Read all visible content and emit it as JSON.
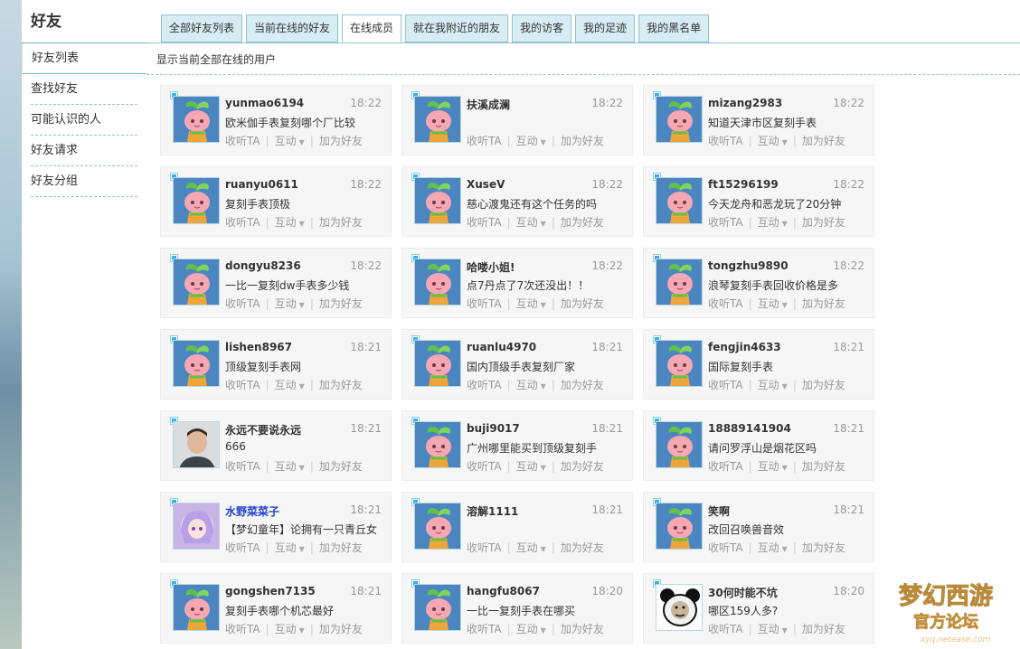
{
  "sidebar": {
    "title": "好友",
    "items": [
      {
        "label": "好友列表"
      },
      {
        "label": "查找好友"
      },
      {
        "label": "可能认识的人"
      },
      {
        "label": "好友请求"
      },
      {
        "label": "好友分组"
      }
    ]
  },
  "tabs": [
    {
      "label": "全部好友列表"
    },
    {
      "label": "当前在线的好友"
    },
    {
      "label": "在线成员"
    },
    {
      "label": "就在我附近的朋友"
    },
    {
      "label": "我的访客"
    },
    {
      "label": "我的足迹"
    },
    {
      "label": "我的黑名单"
    }
  ],
  "subtitle": "显示当前全部在线的用户",
  "actions": {
    "listen": "收听TA",
    "interact": "互动",
    "add_friend": "加为好友"
  },
  "colors": {
    "accent": "#31b6e8",
    "tab_bg": "#d7ecf3",
    "card_bg": "#f6f6f6",
    "vip_name": "#1e3fd0"
  },
  "users": [
    {
      "name": "yunmao6194",
      "time": "18:22",
      "msg": "欧米伽手表复刻哪个厂比较",
      "avatar": "sprout"
    },
    {
      "name": "扶溪成澜",
      "time": "18:22",
      "msg": "",
      "avatar": "sprout"
    },
    {
      "name": "mizang2983",
      "time": "18:22",
      "msg": "知道天津市区复刻手表",
      "avatar": "sprout"
    },
    {
      "name": "ruanyu0611",
      "time": "18:22",
      "msg": "复刻手表顶极",
      "avatar": "sprout"
    },
    {
      "name": "XuseV",
      "time": "18:22",
      "msg": "慈心渡鬼还有这个任务的吗",
      "avatar": "sprout"
    },
    {
      "name": "ft15296199",
      "time": "18:22",
      "msg": "今天龙舟和恶龙玩了20分钟",
      "avatar": "sprout"
    },
    {
      "name": "dongyu8236",
      "time": "18:22",
      "msg": "一比一复刻dw手表多少钱",
      "avatar": "sprout"
    },
    {
      "name": "哈喽小姐!",
      "time": "18:22",
      "msg": "点7丹点了7次还没出！！",
      "avatar": "sprout"
    },
    {
      "name": "tongzhu9890",
      "time": "18:22",
      "msg": "浪琴复刻手表回收价格是多",
      "avatar": "sprout"
    },
    {
      "name": "lishen8967",
      "time": "18:21",
      "msg": "顶级复刻手表网",
      "avatar": "sprout"
    },
    {
      "name": "ruanlu4970",
      "time": "18:21",
      "msg": "国内顶级手表复刻厂家",
      "avatar": "sprout"
    },
    {
      "name": "fengjin4633",
      "time": "18:21",
      "msg": "国际复刻手表",
      "avatar": "sprout"
    },
    {
      "name": "永远不要说永远",
      "time": "18:21",
      "msg": "666",
      "avatar": "photo"
    },
    {
      "name": "buji9017",
      "time": "18:21",
      "msg": "广州哪里能买到顶级复刻手",
      "avatar": "sprout"
    },
    {
      "name": "18889141904",
      "time": "18:21",
      "msg": "请问罗浮山是烟花区吗",
      "avatar": "sprout"
    },
    {
      "name": "水野菜菜子",
      "time": "18:21",
      "msg": "【梦幻童年】论拥有一只青丘女",
      "avatar": "anime",
      "vip": true
    },
    {
      "name": "溶解1111",
      "time": "18:21",
      "msg": "",
      "avatar": "sprout"
    },
    {
      "name": "笑啊",
      "time": "18:21",
      "msg": "改回召唤兽音效",
      "avatar": "sprout"
    },
    {
      "name": "gongshen7135",
      "time": "18:21",
      "msg": "复刻手表哪个机芯最好",
      "avatar": "sprout"
    },
    {
      "name": "hangfu8067",
      "time": "18:20",
      "msg": "一比一复刻手表在哪买",
      "avatar": "sprout"
    },
    {
      "name": "30何时能不坑",
      "time": "18:20",
      "msg": "哪区159人多?",
      "avatar": "panda"
    }
  ],
  "logo": {
    "text": "梦幻西游",
    "subtext": "官方论坛",
    "url": "xyq.netease.com"
  }
}
